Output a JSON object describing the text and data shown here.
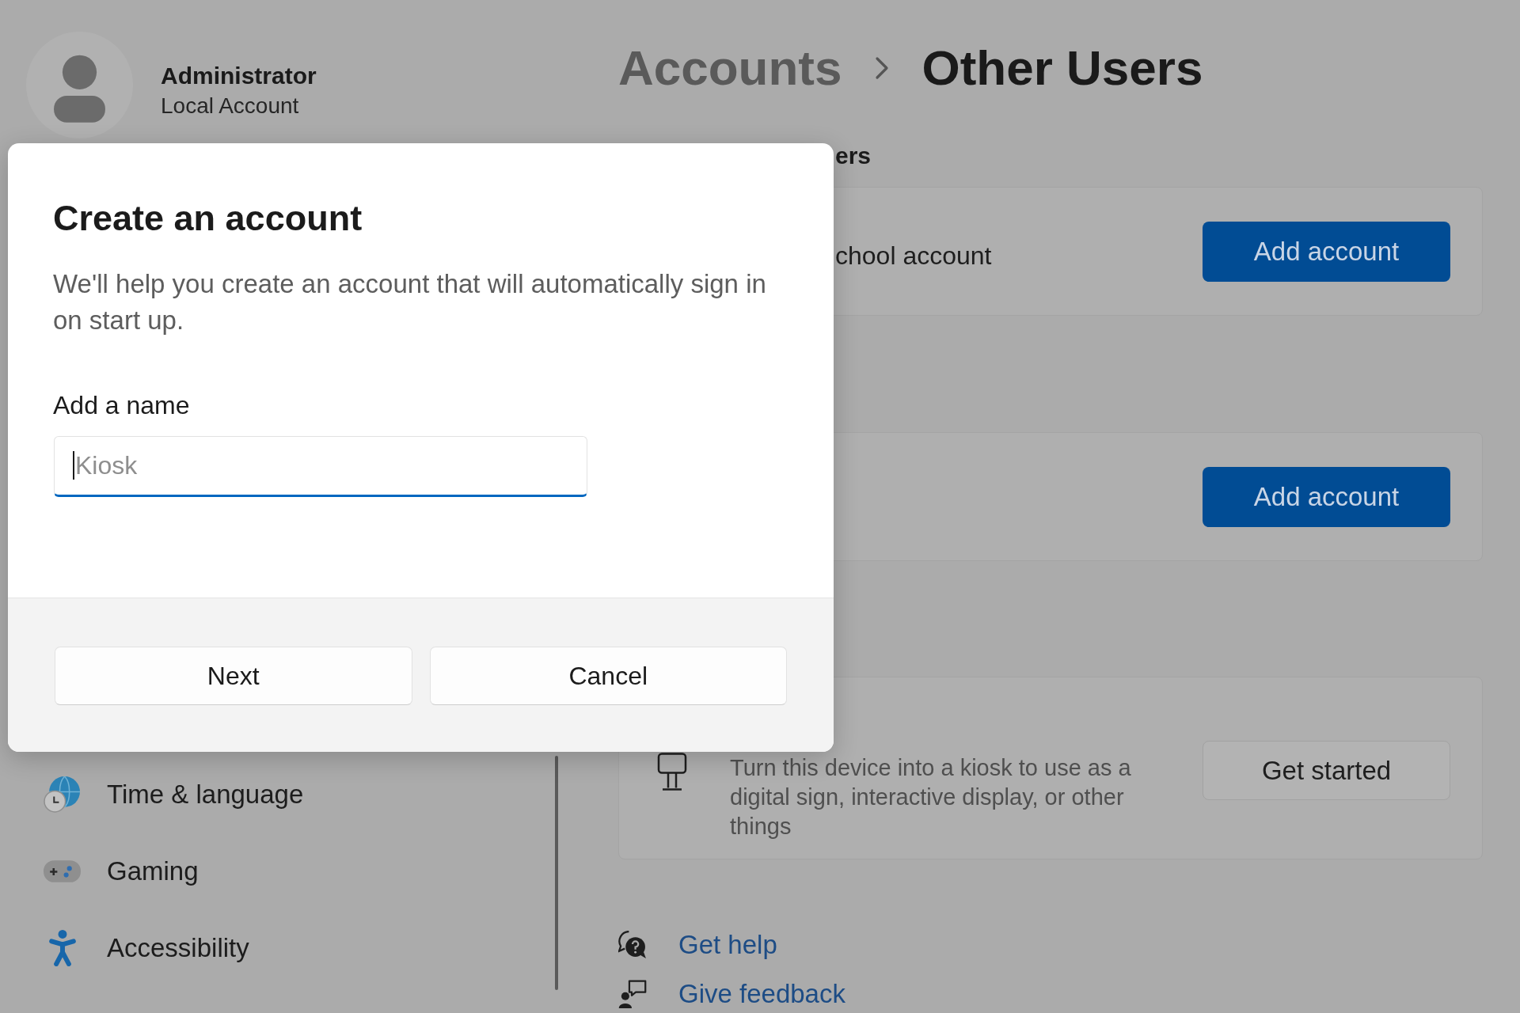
{
  "profile": {
    "name": "Administrator",
    "account_type": "Local Account"
  },
  "breadcrumb": [
    {
      "label": "Accounts",
      "current": false
    },
    {
      "label": "Other Users",
      "current": true
    }
  ],
  "sidebar": {
    "items": [
      {
        "label": "Time & language",
        "selected": false
      },
      {
        "label": "Gaming",
        "selected": false
      },
      {
        "label": "Accessibility",
        "selected": false
      }
    ]
  },
  "section_title": "ers",
  "cards": [
    {
      "kind": "plain",
      "title": "chool account",
      "button": {
        "label": "Add account",
        "kind": "primary"
      }
    },
    {
      "kind": "plain",
      "button": {
        "label": "Add account",
        "kind": "primary"
      }
    },
    {
      "kind": "described",
      "description": "Turn this device into a kiosk to use as a digital sign, interactive display, or other things",
      "button": {
        "label": "Get started",
        "kind": "secondary"
      }
    }
  ],
  "links": [
    {
      "label": "Get help"
    },
    {
      "label": "Give feedback"
    }
  ],
  "dialog": {
    "title": "Create an account",
    "description": "We'll help you create an account that will automatically sign in on start up.",
    "field": {
      "label": "Add a name",
      "placeholder": "Kiosk",
      "focused": true
    },
    "buttons": [
      "Next",
      "Cancel"
    ]
  }
}
